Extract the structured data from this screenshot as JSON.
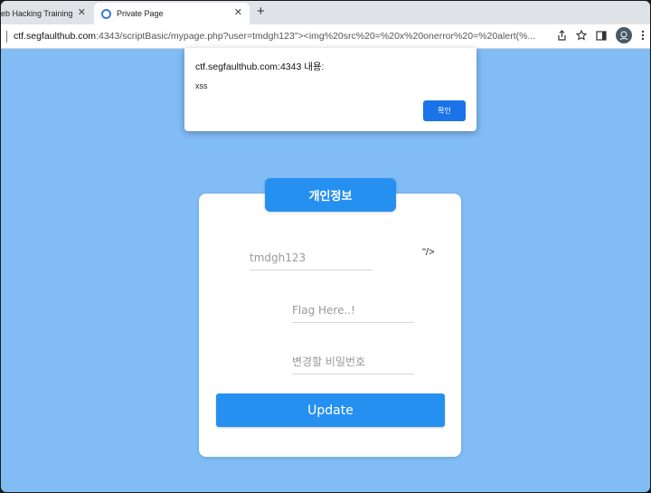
{
  "browser": {
    "tabs": [
      {
        "label": "eb Hacking Training",
        "active": false
      },
      {
        "label": "Private Page",
        "active": true
      }
    ],
    "new_tab_label": "+",
    "close_label": "✕",
    "url_host": "ctf.segfaulthub.com",
    "url_rest": ":4343/scriptBasic/mypage.php?user=tmdgh123\"><img%20src%20=%20x%20onerror%20=%20alert(%..."
  },
  "dialog": {
    "title": "ctf.segfaulthub.com:4343 내용:",
    "message": "xss",
    "ok_label": "확인"
  },
  "form": {
    "header": "개인정보",
    "user_value": "tmdgh123",
    "injected_text": "\"/>",
    "flag_placeholder": "Flag Here..!",
    "password_placeholder": "변경할 비밀번호",
    "update_label": "Update"
  },
  "colors": {
    "page_background": "#81bcf5",
    "accent": "#2690f0",
    "dialog_button": "#1a73e8"
  }
}
